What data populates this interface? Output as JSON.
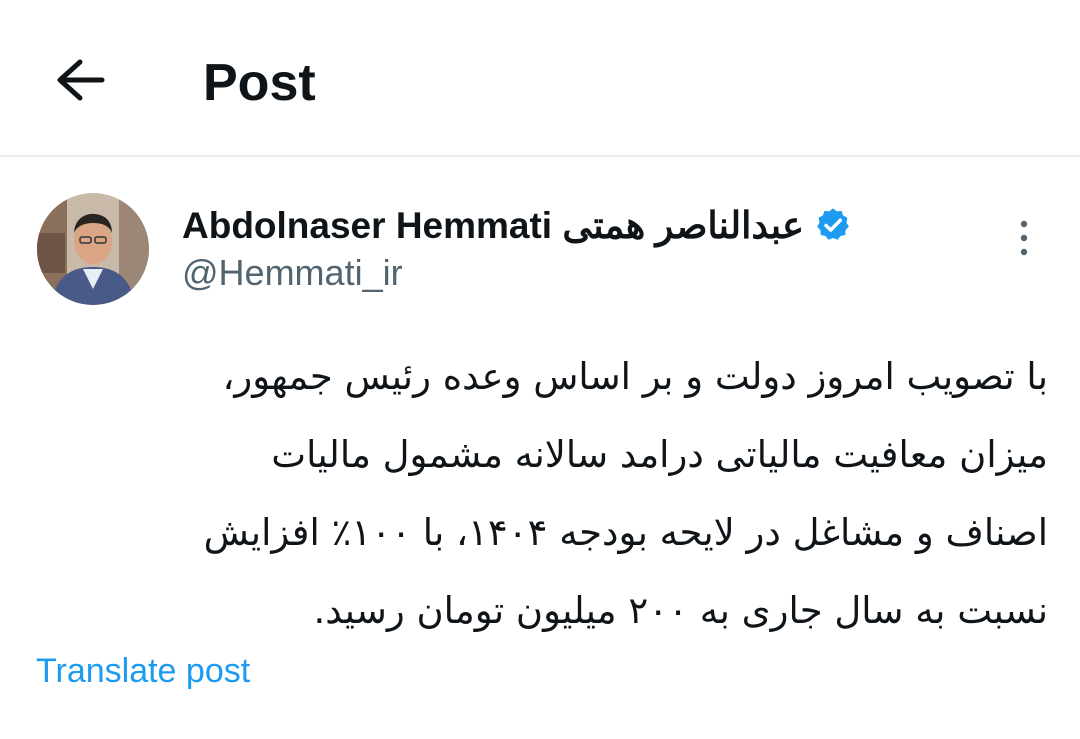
{
  "header": {
    "title": "Post",
    "back_icon": "arrow-left-icon"
  },
  "author": {
    "display_name": "Abdolnaser Hemmati عبدالناصر همتی",
    "handle": "@Hemmati_ir",
    "verified_icon": "verified-badge-icon",
    "verified_color": "#1d9bf0"
  },
  "post": {
    "lines": [
      "با تصویب امروز دولت و بر اساس وعده رئیس جمهور،",
      "میزان معافیت مالیاتی درامد سالانه مشمول مالیات",
      "اصناف و مشاغل در لایحه بودجه ۱۴۰۴، با ۱۰۰٪ افزایش",
      "نسبت به سال جاری به ۲۰۰ میلیون تومان رسید."
    ],
    "more_icon": "more-vertical-icon"
  },
  "actions": {
    "translate_label": "Translate post"
  },
  "colors": {
    "accent": "#1d9bf0",
    "secondary_text": "#536471",
    "primary_text": "#0f1419",
    "divider": "#e6ecf0"
  }
}
